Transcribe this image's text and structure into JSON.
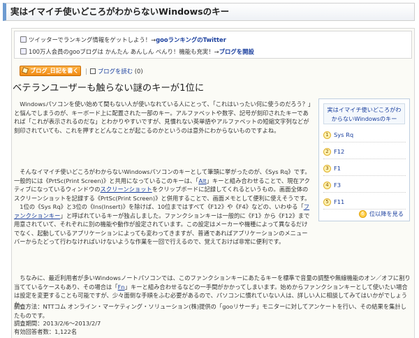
{
  "header": {
    "title": "実はイマイチ使いどころがわからないWindowsのキー"
  },
  "promo": {
    "line1_text": "ツイッターでランキング情報をゲットしよう！→",
    "line1_link": "gooランキングのTwitter",
    "line2_text": "100万人会員のgooブログは かんたん あんしん べんり！機能も充実！→",
    "line2_link": "ブログを開設"
  },
  "actions": {
    "blog_button": "ブログ_日記を書く",
    "read_link": "ブログを読む",
    "read_count": "(0)"
  },
  "article": {
    "headline": "ベテランユーザーも触らない謎のキーが1位に",
    "p1": "　Windowsパソコンを使い始めて間もない人が使いなれている人にとって、「これはいったい何に使うのだろう？」と悩んでしまうのが、キーボード上に配置された一部のキー。アルファベットや数字、記号が刻印されたキーであれば「これが表示されるのだな」とわかりやすいですが、見慣れない英単語やアルファベットの短縮文字列などが刻印されていても、これを押すとどんなことが起こるのかというのは意外にわからないものですよね。",
    "p2_a": "　そんなイマイチ使いどころがわからないWindowsパソコンのキーとして筆頭に挙がったのが、《Sys Rq》です。一般的には《PrtSc(Print Screen)》と共用になっているこのキーは、「",
    "p2_link1": "Alt",
    "p2_b": "」キーと組み合わせることで、現在アクティブになっているウィンドウの",
    "p2_link2": "スクリーンショット",
    "p2_c": "をクリップボードに記録してくれるというもの。画面全体のスクリーンショットを記録する《PrtSc(Print Screen)》と併用することで、画面メモとして便利に使えそうです。\n　1位の《Sys Rq》と3位の《Ins(Insert)》を除けば、10位まではすべて《F12》や《F4》などの、いわゆる「",
    "p2_link3": "ファンクションキー",
    "p2_d": "」と呼ばれているキーが独占しました。ファンクションキーは一般的に《F1》から《F12》まで用意されていて、それぞれに別の機能や動作が設定されています。この設定はメーカーや機種によって異なるだけでなく、起動しているアプリケーションによっても変わってきますが、普通であればアプリケーションのメニューバーからたどって行わなければいけないような作業を一回で行えるので、覚えておけば非常に便利です。",
    "p3_a": "　ちなみに、最近利用者が多いWindowsノートパソコンでは、このファンクションキーにあたるキーを標準で音量の調整や無線機能のオン／オフに割り当てているケースもあり、その場合は「",
    "p3_link": "Fn",
    "p3_b": "」キーと組み合わせるなどの一手間がかかってしまいます。始めからファンクションキーとして使いたい場合は設定を変更することも可能ですが、少々面倒な手順をふむ必要があるので、パソコンに慣れていない人は、詳しい人に相談してみてはいかがでしょうか。",
    "survey_target": "調査方法：NTTコム オンライン・マーケティング・ソリューション(株)提供の「gooリサーチ」モニターに対してアンケートを行い、その結果を集計したものです。",
    "survey_period": "調査期間：2013/2/6～2013/2/7",
    "survey_count": "有効回答者数：1,122名"
  },
  "ranking": {
    "title_line1": "実はイマイチ使いどころがわ",
    "title_line2": "からないWindowsのキー",
    "items": [
      {
        "num": "1",
        "label": "Sys Rq"
      },
      {
        "num": "2",
        "label": "F12"
      },
      {
        "num": "3",
        "label": "F1"
      },
      {
        "num": "4",
        "label": "F3"
      },
      {
        "num": "5",
        "label": "F11"
      }
    ],
    "more_num": "6",
    "more_label": "位以降を見る"
  }
}
